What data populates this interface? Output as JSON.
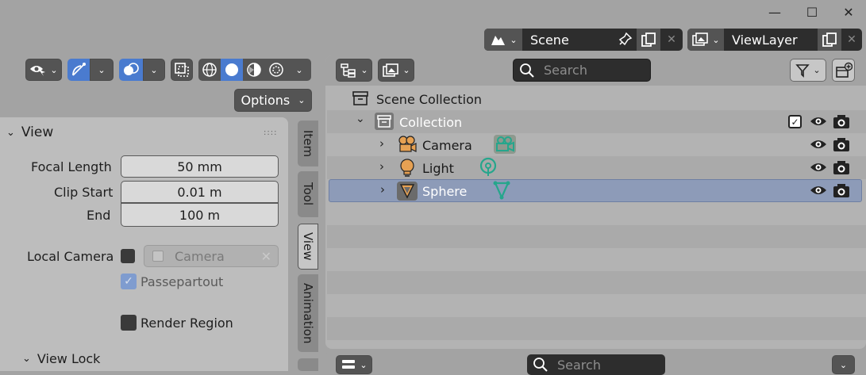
{
  "window": {
    "minimize": "—",
    "maximize": "☐",
    "close": "✕"
  },
  "scene": {
    "name": "Scene"
  },
  "viewlayer": {
    "name": "ViewLayer"
  },
  "viewport_header": {
    "options_label": "Options"
  },
  "sidebar": {
    "view_panel": {
      "title": "View",
      "focal_length": {
        "label": "Focal Length",
        "value": "50 mm"
      },
      "clip_start": {
        "label": "Clip Start",
        "value": "0.01 m"
      },
      "clip_end": {
        "label": "End",
        "value": "100 m"
      },
      "local_camera": {
        "label": "Local Camera",
        "value": "Camera"
      },
      "passepartout": {
        "label": "Passepartout"
      },
      "render_region": {
        "label": "Render Region"
      }
    },
    "view_lock": {
      "title": "View Lock"
    },
    "tabs": [
      "Item",
      "Tool",
      "View",
      "Animation"
    ]
  },
  "outliner": {
    "search_placeholder": "Search",
    "root": "Scene Collection",
    "collection": "Collection",
    "items": [
      {
        "name": "Camera"
      },
      {
        "name": "Light"
      },
      {
        "name": "Sphere"
      }
    ]
  },
  "bottom_editor": {
    "search_placeholder": "Search"
  },
  "colors": {
    "selected_row": "#8d9bb8",
    "camera_accent": "#e6a153",
    "data_green": "#26a68c",
    "sphere_orange": "#e6a153"
  }
}
